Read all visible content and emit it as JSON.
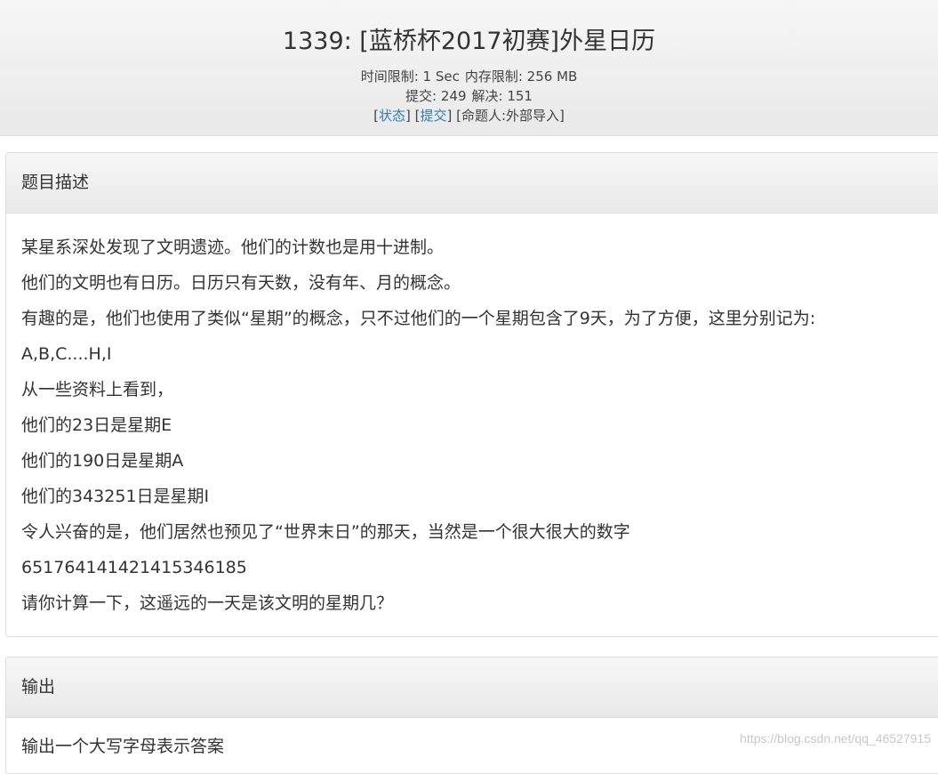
{
  "header": {
    "title": "1339: [蓝桥杯2017初赛]外星日历",
    "time_limit_label": "时间限制: 1 Sec",
    "memory_limit_label": "内存限制: 256 MB",
    "submit_label": "提交: 249",
    "solved_label": "解决: 151",
    "status_link": "状态",
    "submit_link": "提交",
    "author": "[命题人:外部导入]"
  },
  "description": {
    "heading": "题目描述",
    "lines": [
      "某星系深处发现了文明遗迹。他们的计数也是用十进制。",
      "他们的文明也有日历。日历只有天数，没有年、月的概念。",
      "有趣的是，他们也使用了类似“星期”的概念，只不过他们的一个星期包含了9天，为了方便，这里分别记为:",
      "A,B,C....H,I",
      "从一些资料上看到，",
      "他们的23日是星期E",
      "他们的190日是星期A",
      "他们的343251日是星期I",
      "令人兴奋的是，他们居然也预见了“世界末日”的那天，当然是一个很大很大的数字",
      "651764141421415346185",
      "请你计算一下，这遥远的一天是该文明的星期几？"
    ]
  },
  "output": {
    "heading": "输出",
    "text": "输出一个大写字母表示答案"
  },
  "watermark": "https://blog.csdn.net/qq_46527915"
}
